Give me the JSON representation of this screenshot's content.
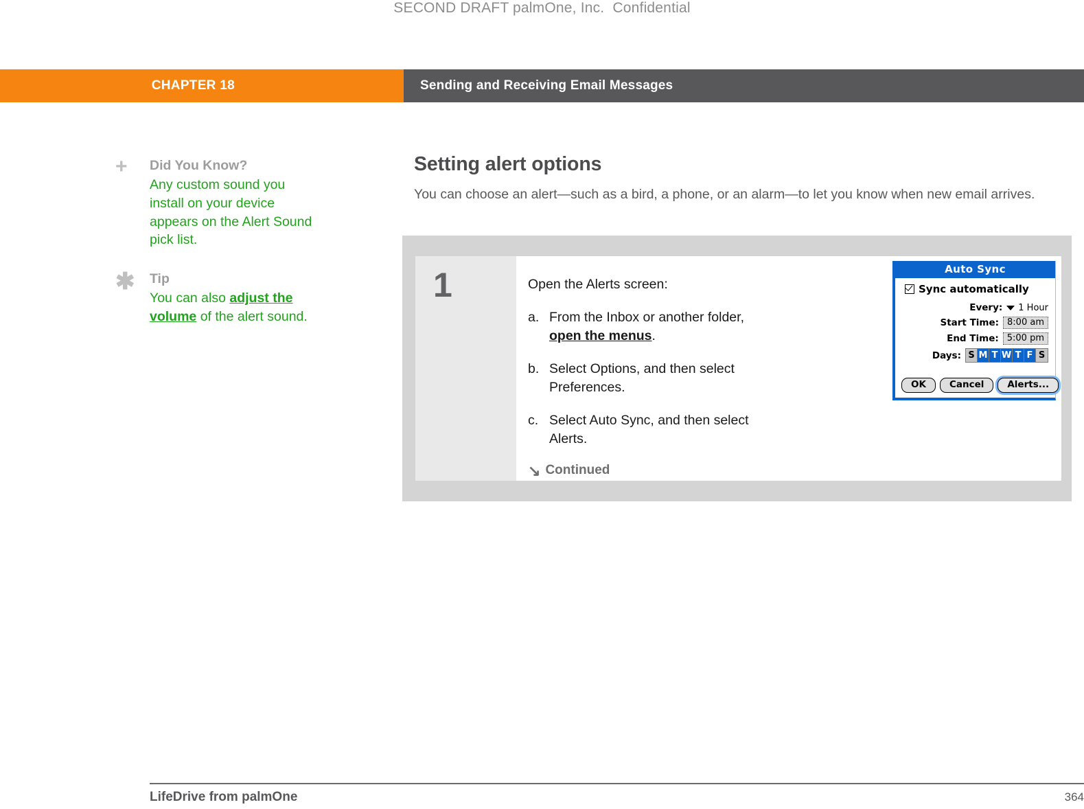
{
  "draft_notice": "SECOND DRAFT palmOne, Inc.  Confidential",
  "header": {
    "chapter_label": "CHAPTER 18",
    "chapter_title": "Sending and Receiving Email Messages",
    "orange_hex": "#f58510",
    "gray_hex": "#58585a"
  },
  "sidebar": {
    "notes": [
      {
        "icon": "plus-icon",
        "heading": "Did You Know?",
        "body": "Any custom sound you install on your device appears on the Alert Sound pick list."
      },
      {
        "icon": "asterisk-icon",
        "heading": "Tip",
        "body_before": "You can also ",
        "link": "adjust the volume",
        "body_after": " of the alert sound."
      }
    ],
    "heading_color": "#9d9d9d",
    "body_color": "#22a31d"
  },
  "main": {
    "title": "Setting alert options",
    "intro": "You can choose an alert—such as a bird, a phone, or an alarm—to let you know when new email arrives."
  },
  "step": {
    "number": "1",
    "lead": "Open the Alerts screen:",
    "substeps": [
      {
        "mark": "a.",
        "text_before": "From the Inbox or another folder, ",
        "link": "open the menus",
        "text_after": "."
      },
      {
        "mark": "b.",
        "text_before": "Select Options, and then select Preferences.",
        "link": "",
        "text_after": ""
      },
      {
        "mark": "c.",
        "text_before": "Select Auto Sync, and then select Alerts.",
        "link": "",
        "text_after": ""
      }
    ],
    "continued_arrow": "↘",
    "continued_label": "Continued"
  },
  "palm_dialog": {
    "title": "Auto Sync",
    "checkbox_label": "Sync automatically",
    "checkbox_checked": true,
    "every_label": "Every:",
    "every_value": "1 Hour",
    "start_time_label": "Start Time:",
    "start_time_value": "8:00 am",
    "end_time_label": "End Time:",
    "end_time_value": "5:00 pm",
    "days_label": "Days:",
    "days": [
      {
        "letter": "S",
        "selected": false
      },
      {
        "letter": "M",
        "selected": true
      },
      {
        "letter": "T",
        "selected": true
      },
      {
        "letter": "W",
        "selected": true
      },
      {
        "letter": "T",
        "selected": true
      },
      {
        "letter": "F",
        "selected": true
      },
      {
        "letter": "S",
        "selected": false
      }
    ],
    "ok_label": "OK",
    "cancel_label": "Cancel",
    "alerts_label": "Alerts...",
    "accent_hex": "#0b63cc"
  },
  "footer": {
    "product": "LifeDrive from palmOne",
    "page_number": "364"
  }
}
